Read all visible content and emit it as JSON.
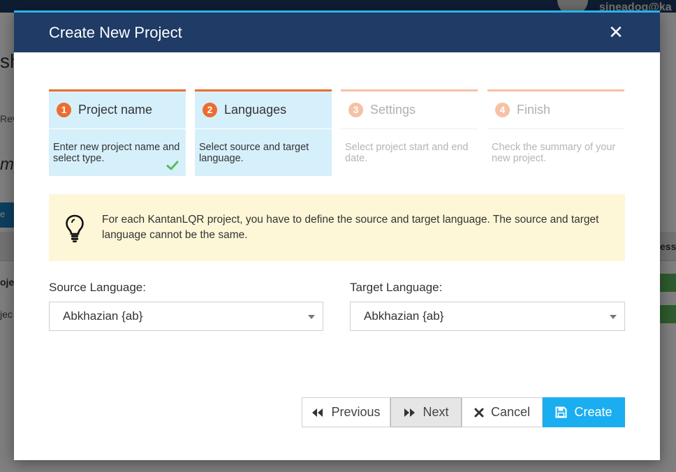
{
  "background": {
    "user": "sineadog@ka",
    "heading": "sh",
    "tab": "Rev",
    "title": "mp",
    "button": "e",
    "column": "ess",
    "row1": "ojec",
    "row2": "jec"
  },
  "modal": {
    "title": "Create New Project",
    "close_icon": "close-icon"
  },
  "steps": [
    {
      "number": "1",
      "label": "Project name",
      "description": "Enter new project name and select type.",
      "state": "completed"
    },
    {
      "number": "2",
      "label": "Languages",
      "description": "Select source and target language.",
      "state": "current"
    },
    {
      "number": "3",
      "label": "Settings",
      "description": "Select project start and end date.",
      "state": "pending"
    },
    {
      "number": "4",
      "label": "Finish",
      "description": "Check the summary of your new project.",
      "state": "pending"
    }
  ],
  "info": {
    "icon": "lightbulb-icon",
    "text": "For each KantanLQR project, you have to define the source and target language. The source and target language cannot be the same."
  },
  "source": {
    "label": "Source Language:",
    "value": "Abkhazian {ab}"
  },
  "target": {
    "label": "Target Language:",
    "value": "Abkhazian {ab}"
  },
  "buttons": {
    "previous": "Previous",
    "next": "Next",
    "cancel": "Cancel",
    "create": "Create"
  },
  "colors": {
    "header": "#1f3b66",
    "accent": "#27b5ed",
    "step_active": "#ec6d2f",
    "step_inactive": "#f6c1a5",
    "create_button": "#1aaef0",
    "info_background": "#fdf7d8"
  }
}
